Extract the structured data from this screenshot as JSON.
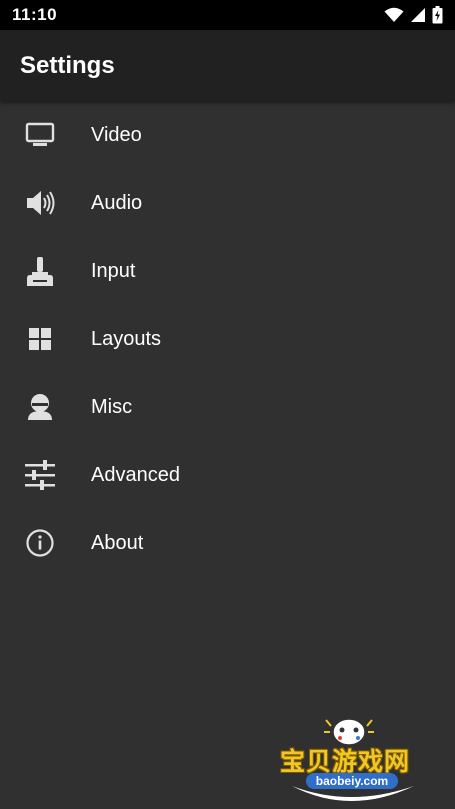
{
  "status_bar": {
    "time": "11:10",
    "icons": [
      "wifi-icon",
      "cell-signal-icon",
      "battery-icon"
    ]
  },
  "app_bar": {
    "title": "Settings"
  },
  "menu": {
    "items": [
      {
        "label": "Video",
        "icon": "monitor-icon"
      },
      {
        "label": "Audio",
        "icon": "speaker-icon"
      },
      {
        "label": "Input",
        "icon": "joystick-icon"
      },
      {
        "label": "Layouts",
        "icon": "grid-icon"
      },
      {
        "label": "Misc",
        "icon": "person-icon"
      },
      {
        "label": "Advanced",
        "icon": "sliders-icon"
      },
      {
        "label": "About",
        "icon": "info-icon"
      }
    ]
  },
  "watermark": {
    "text": "宝贝游戏网",
    "url": "baobeiy.com"
  },
  "colors": {
    "status_bar": "#000000",
    "app_bar": "#212121",
    "background": "#303030",
    "text": "#ffffff",
    "icon": "#e0e0e0"
  }
}
